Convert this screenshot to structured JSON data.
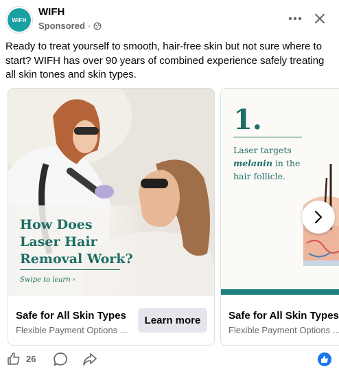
{
  "post": {
    "page_name": "WIFH",
    "avatar_text": "WIFH",
    "sponsored_label": "Sponsored",
    "meta_separator": "·",
    "icons": {
      "privacy": "globe-icon",
      "more": "more-dots-icon",
      "close": "close-x-icon"
    },
    "caption": "Ready to treat yourself to smooth, hair-free skin but not sure where to start? WIFH has over 90 years of combined experience safely treating all skin tones and skin types."
  },
  "carousel": {
    "cards": [
      {
        "headline_lines": [
          "How Does",
          "Laser Hair",
          "Removal Work?"
        ],
        "swipe_text": "Swipe to learn  ›",
        "title": "Safe for All Skin Types",
        "subtitle": "Flexible Payment Options ...",
        "cta_label": "Learn more"
      },
      {
        "step_number": "1.",
        "text_before": "Laser targets",
        "text_emphasis": "melanin",
        "text_after": "in the hair follicle.",
        "title": "Safe for All Skin Types",
        "subtitle": "Flexible Payment Options ..."
      }
    ],
    "next_icon": "chevron-right-icon"
  },
  "actions": {
    "like_count": "26",
    "like_icon": "thumbs-up-icon",
    "comment_icon": "comment-bubble-icon",
    "share_icon": "share-arrow-icon",
    "reaction_icon": "like-reaction-icon"
  },
  "colors": {
    "brand_teal": "#1e6e66",
    "avatar_teal": "#1a9fa3",
    "facebook_blue": "#1877f2",
    "secondary_text": "#65676b",
    "button_gray": "#e4e6eb"
  }
}
